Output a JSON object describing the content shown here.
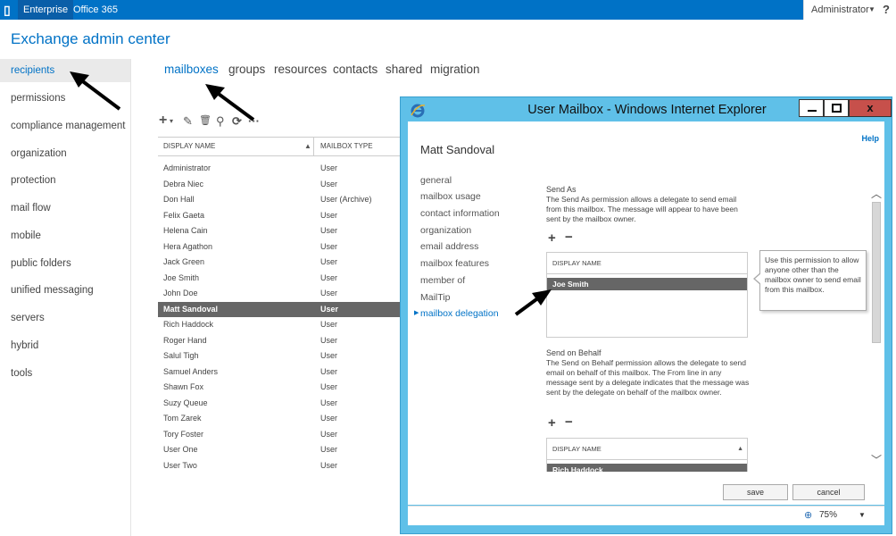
{
  "topbar": {
    "logo": "office-logo",
    "enterprise": "Enterprise",
    "office365": "Office 365",
    "admin": "Administrator",
    "help": "?"
  },
  "app_title": "Exchange admin center",
  "leftnav": {
    "items": [
      {
        "label": "recipients",
        "active": true
      },
      {
        "label": "permissions"
      },
      {
        "label": "compliance management"
      },
      {
        "label": "organization"
      },
      {
        "label": "protection"
      },
      {
        "label": "mail flow"
      },
      {
        "label": "mobile"
      },
      {
        "label": "public folders"
      },
      {
        "label": "unified messaging"
      },
      {
        "label": "servers"
      },
      {
        "label": "hybrid"
      },
      {
        "label": "tools"
      }
    ]
  },
  "subtabs": [
    {
      "label": "mailboxes",
      "active": true
    },
    {
      "label": "groups"
    },
    {
      "label": "resources"
    },
    {
      "label": "contacts"
    },
    {
      "label": "shared"
    },
    {
      "label": "migration"
    }
  ],
  "toolbar": {
    "add": "+",
    "add_caret": "▾",
    "edit": "✎",
    "delete": "🗑",
    "search": "⚲",
    "refresh": "⟳",
    "more": "···"
  },
  "table": {
    "col1": "DISPLAY NAME",
    "col2": "MAILBOX TYPE",
    "sort_glyph": "▲",
    "rows": [
      {
        "name": "Administrator",
        "type": "User"
      },
      {
        "name": "Debra Niec",
        "type": "User"
      },
      {
        "name": "Don Hall",
        "type": "User (Archive)"
      },
      {
        "name": "Felix Gaeta",
        "type": "User"
      },
      {
        "name": "Helena Cain",
        "type": "User"
      },
      {
        "name": "Hera Agathon",
        "type": "User"
      },
      {
        "name": "Jack Green",
        "type": "User"
      },
      {
        "name": "Joe Smith",
        "type": "User"
      },
      {
        "name": "John Doe",
        "type": "User"
      },
      {
        "name": "Matt Sandoval",
        "type": "User",
        "selected": true
      },
      {
        "name": "Rich Haddock",
        "type": "User"
      },
      {
        "name": "Roger Hand",
        "type": "User"
      },
      {
        "name": "Salul Tigh",
        "type": "User"
      },
      {
        "name": "Samuel Anders",
        "type": "User"
      },
      {
        "name": "Shawn Fox",
        "type": "User"
      },
      {
        "name": "Suzy Queue",
        "type": "User"
      },
      {
        "name": "Tom Zarek",
        "type": "User"
      },
      {
        "name": "Tory Foster",
        "type": "User"
      },
      {
        "name": "User One",
        "type": "User"
      },
      {
        "name": "User Two",
        "type": "User"
      }
    ]
  },
  "dialog": {
    "title": "User Mailbox - Windows Internet Explorer",
    "close_glyph": "x",
    "help": "Help",
    "user_name": "Matt Sandoval",
    "nav": [
      {
        "label": "general"
      },
      {
        "label": "mailbox usage"
      },
      {
        "label": "contact information"
      },
      {
        "label": "organization"
      },
      {
        "label": "email address"
      },
      {
        "label": "mailbox features"
      },
      {
        "label": "member of"
      },
      {
        "label": "MailTip"
      },
      {
        "label": "mailbox delegation",
        "active": true
      }
    ],
    "nav_bullet": "▶",
    "send_as": {
      "title": "Send As",
      "desc": "The Send As permission allows a delegate to send email from this mailbox. The message will appear to have been sent by the mailbox owner.",
      "plus": "+",
      "minus": "−",
      "header": "DISPLAY NAME",
      "entry": "Joe Smith"
    },
    "tooltip": "Use this permission to allow anyone other than the mailbox owner to send email from this mailbox.",
    "send_on_behalf": {
      "title": "Send on Behalf",
      "desc": "The Send on Behalf permission allows the delegate to send email on behalf of this mailbox. The From line in any message sent by a delegate indicates that the message was sent by the delegate on behalf of the mailbox owner.",
      "plus": "+",
      "minus": "−",
      "header": "DISPLAY NAME",
      "sort_glyph": "▲",
      "entry": "Rich Haddock"
    },
    "scroll_up": "︿",
    "scroll_down": "﹀",
    "save": "save",
    "cancel": "cancel",
    "zoom_icon": "⊕",
    "zoom": "75%",
    "zoom_caret": "▼"
  },
  "colors": {
    "accent": "#0072c6",
    "dialog_frame": "#5fc0e8",
    "selected_row": "#666666",
    "close_button": "#c7504b"
  }
}
